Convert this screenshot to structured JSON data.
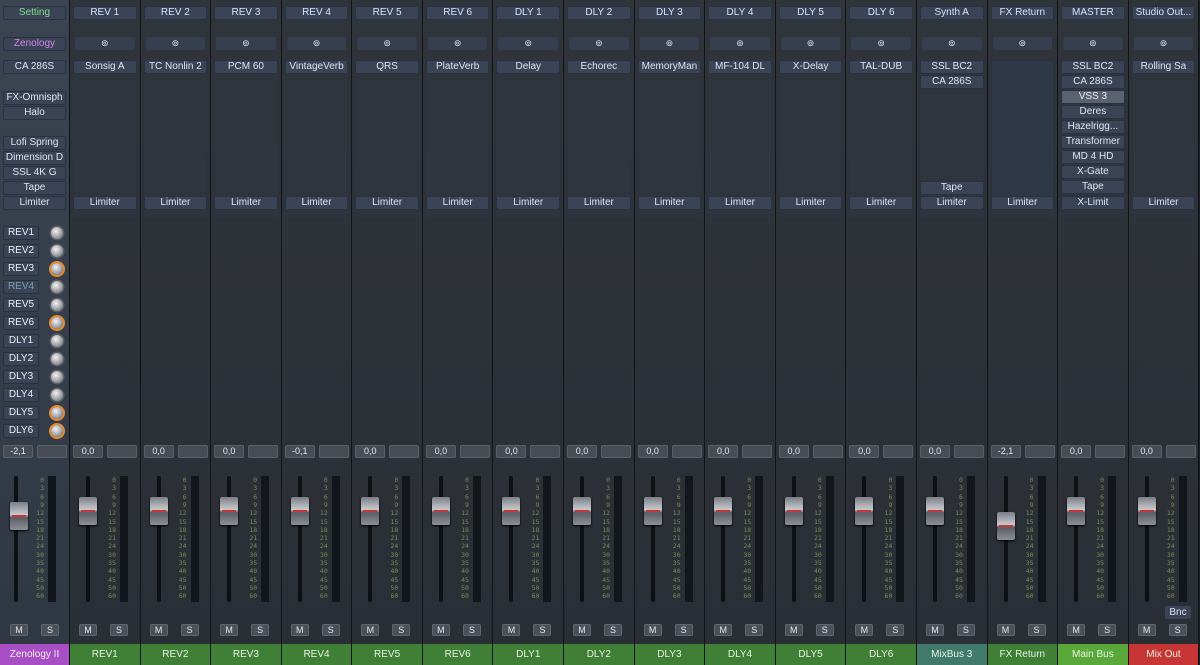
{
  "first_strip": {
    "setting": "Setting",
    "zenology": "Zenology",
    "input": "CA 286S",
    "inserts": [
      "FX-Omnisph",
      "Halo",
      "Lofi Spring",
      "Dimension D",
      "SSL 4K G",
      "Tape",
      "Limiter"
    ],
    "sends": [
      {
        "label": "REV1",
        "muted": false,
        "orange": false
      },
      {
        "label": "REV2",
        "muted": false,
        "orange": false
      },
      {
        "label": "REV3",
        "muted": false,
        "orange": true
      },
      {
        "label": "REV4",
        "muted": true,
        "orange": false
      },
      {
        "label": "REV5",
        "muted": false,
        "orange": false
      },
      {
        "label": "REV6",
        "muted": false,
        "orange": true
      },
      {
        "label": "DLY1",
        "muted": false,
        "orange": false
      },
      {
        "label": "DLY2",
        "muted": false,
        "orange": false
      },
      {
        "label": "DLY3",
        "muted": false,
        "orange": false
      },
      {
        "label": "DLY4",
        "muted": false,
        "orange": false
      },
      {
        "label": "DLY5",
        "muted": false,
        "orange": true
      },
      {
        "label": "DLY6",
        "muted": false,
        "orange": true
      }
    ],
    "pan": "-2,1",
    "mute": "M",
    "solo": "S",
    "name": "Zenology II",
    "name_color": "#a94fc6",
    "fader_level": 0.32
  },
  "link_symbol": "⊚",
  "scale_marks": [
    "0",
    "3",
    "6",
    "9",
    "12",
    "15",
    "18",
    "21",
    "24",
    "30",
    "35",
    "40",
    "45",
    "50",
    "60"
  ],
  "channels": [
    {
      "io": "REV 1",
      "inserts": [
        "Sonsig A"
      ],
      "limiter": "Limiter",
      "pan": "0,0",
      "name": "REV1",
      "color": "#3f7f36",
      "fader_level": 0.28
    },
    {
      "io": "REV 2",
      "inserts": [
        "TC Nonlin 2"
      ],
      "limiter": "Limiter",
      "pan": "0,0",
      "name": "REV2",
      "color": "#3f7f36",
      "fader_level": 0.28
    },
    {
      "io": "REV 3",
      "inserts": [
        "PCM 60"
      ],
      "limiter": "Limiter",
      "pan": "0,0",
      "name": "REV3",
      "color": "#3f7f36",
      "fader_level": 0.28
    },
    {
      "io": "REV 4",
      "inserts": [
        "VintageVerb"
      ],
      "limiter": "Limiter",
      "pan": "-0,1",
      "name": "REV4",
      "color": "#3f7f36",
      "fader_level": 0.28
    },
    {
      "io": "REV 5",
      "inserts": [
        "QRS"
      ],
      "limiter": "Limiter",
      "pan": "0,0",
      "name": "REV5",
      "color": "#3f7f36",
      "fader_level": 0.28
    },
    {
      "io": "REV 6",
      "inserts": [
        "PlateVerb"
      ],
      "limiter": "Limiter",
      "pan": "0,0",
      "name": "REV6",
      "color": "#3f7f36",
      "fader_level": 0.28
    },
    {
      "io": "DLY 1",
      "inserts": [
        "Delay"
      ],
      "limiter": "Limiter",
      "pan": "0,0",
      "name": "DLY1",
      "color": "#3f7f36",
      "fader_level": 0.28
    },
    {
      "io": "DLY 2",
      "inserts": [
        "Echorec"
      ],
      "limiter": "Limiter",
      "pan": "0,0",
      "name": "DLY2",
      "color": "#3f7f36",
      "fader_level": 0.28
    },
    {
      "io": "DLY 3",
      "inserts": [
        "MemoryMan"
      ],
      "limiter": "Limiter",
      "pan": "0,0",
      "name": "DLY3",
      "color": "#3f7f36",
      "fader_level": 0.28
    },
    {
      "io": "DLY 4",
      "inserts": [
        "MF-104 DL"
      ],
      "limiter": "Limiter",
      "pan": "0,0",
      "name": "DLY4",
      "color": "#3f7f36",
      "fader_level": 0.28
    },
    {
      "io": "DLY 5",
      "inserts": [
        "X-Delay"
      ],
      "limiter": "Limiter",
      "pan": "0,0",
      "name": "DLY5",
      "color": "#3f7f36",
      "fader_level": 0.28
    },
    {
      "io": "DLY 6",
      "inserts": [
        "TAL-DUB"
      ],
      "limiter": "Limiter",
      "pan": "0,0",
      "name": "DLY6",
      "color": "#3f7f36",
      "fader_level": 0.28
    },
    {
      "io": "Synth A",
      "inserts": [
        "SSL BC2",
        "CA 286S"
      ],
      "extra": "Tape",
      "limiter": "Limiter",
      "pan": "0,0",
      "name": "MixBus 3",
      "color": "#3f7a6a",
      "fader_level": 0.28
    },
    {
      "io": "FX Return",
      "inserts": [],
      "limiter": "Limiter",
      "pan": "-2,1",
      "name": "FX Return",
      "color": "#3f7f36",
      "fader_level": 0.4
    },
    {
      "io": "MASTER",
      "inserts": [
        "SSL BC2",
        "CA 286S",
        "VSS 3",
        "Deres",
        "Hazelrigg...",
        "Transformer",
        "MD 4 HD",
        "X-Gate",
        "Tape"
      ],
      "limiter": "X-Limit",
      "pan": "0,0",
      "name": "Main Bus",
      "color": "#5aa83a",
      "fader_level": 0.28
    },
    {
      "io": "Studio Out...",
      "inserts": [
        "Rolling Sa"
      ],
      "limiter": "Limiter",
      "pan": "0,0",
      "name": "Mix Out",
      "color": "#c73535",
      "fader_level": 0.28
    }
  ],
  "bounce": "Bnc"
}
